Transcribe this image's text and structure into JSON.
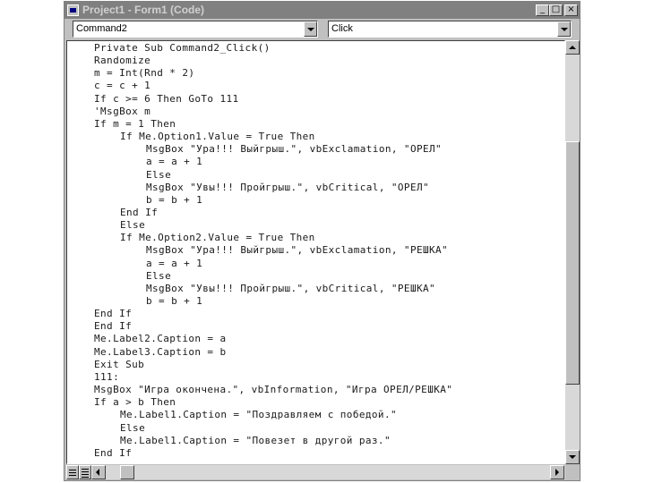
{
  "window": {
    "title": "Project1 - Form1 (Code)",
    "minimize_glyph": "_",
    "maximize_glyph": "□",
    "close_glyph": "×"
  },
  "object_combo": {
    "value": "Command2"
  },
  "procedure_combo": {
    "value": "Click"
  },
  "code_lines": [
    {
      "indent": 0,
      "text": "Private Sub Command2_Click()"
    },
    {
      "indent": 0,
      "text": "Randomize"
    },
    {
      "indent": 0,
      "text": "m = Int(Rnd * 2)"
    },
    {
      "indent": 0,
      "text": "c = c + 1"
    },
    {
      "indent": 0,
      "text": "If c >= 6 Then GoTo 111"
    },
    {
      "indent": 0,
      "text": "'MsgBox m"
    },
    {
      "indent": 0,
      "text": "If m = 1 Then"
    },
    {
      "indent": 1,
      "text": "If Me.Option1.Value = True Then"
    },
    {
      "indent": 2,
      "text": "MsgBox \"Ура!!! Выйгрыш.\", vbExclamation, \"ОРЕЛ\""
    },
    {
      "indent": 2,
      "text": "a = a + 1"
    },
    {
      "indent": 2,
      "text": "Else"
    },
    {
      "indent": 2,
      "text": "MsgBox \"Увы!!! Пройгрыш.\", vbCritical, \"ОРЕЛ\""
    },
    {
      "indent": 2,
      "text": "b = b + 1"
    },
    {
      "indent": 1,
      "text": "End If"
    },
    {
      "indent": 1,
      "text": "Else"
    },
    {
      "indent": 1,
      "text": "If Me.Option2.Value = True Then"
    },
    {
      "indent": 2,
      "text": "MsgBox \"Ура!!! Выйгрыш.\", vbExclamation, \"РЕШКА\""
    },
    {
      "indent": 2,
      "text": "a = a + 1"
    },
    {
      "indent": 2,
      "text": "Else"
    },
    {
      "indent": 2,
      "text": "MsgBox \"Увы!!! Пройгрыш.\", vbCritical, \"РЕШКА\""
    },
    {
      "indent": 2,
      "text": "b = b + 1"
    },
    {
      "indent": 0,
      "text": "End If"
    },
    {
      "indent": 0,
      "text": "End If"
    },
    {
      "indent": 0,
      "text": "Me.Label2.Caption = a"
    },
    {
      "indent": 0,
      "text": "Me.Label3.Caption = b"
    },
    {
      "indent": 0,
      "text": "Exit Sub"
    },
    {
      "indent": 0,
      "text": "111:"
    },
    {
      "indent": 0,
      "text": "MsgBox \"Игра окончена.\", vbInformation, \"Игра ОРЕЛ/РЕШКА\""
    },
    {
      "indent": 0,
      "text": "If a > b Then"
    },
    {
      "indent": 1,
      "text": "Me.Label1.Caption = \"Поздравляем с победой.\""
    },
    {
      "indent": 1,
      "text": "Else"
    },
    {
      "indent": 1,
      "text": "Me.Label1.Caption = \"Повезет в другой раз.\""
    },
    {
      "indent": 0,
      "text": "End If"
    }
  ],
  "colors": {
    "titlebar": "#808080",
    "face": "#c0c0c0",
    "editor_bg": "#ffffff"
  }
}
